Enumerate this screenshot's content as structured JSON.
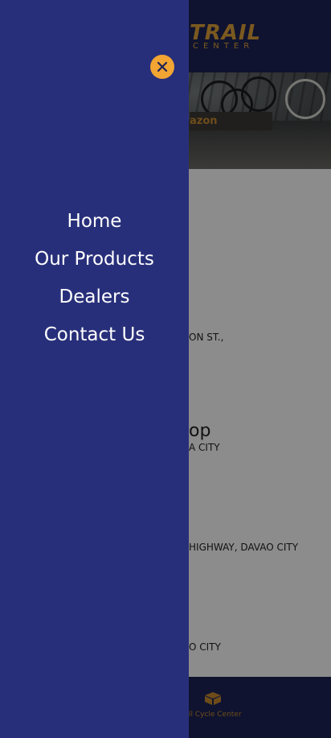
{
  "header": {
    "logo_main": "TRAIL",
    "logo_sub": "CENTER"
  },
  "hero": {
    "shop_button_label": "azon"
  },
  "dealers": [
    {
      "line": "ON ST.,"
    },
    {
      "title_fragment": "op",
      "line": "A CITY"
    },
    {
      "line": "HIGHWAY, DAVAO CITY"
    },
    {
      "line": "O CITY"
    }
  ],
  "bottom_nav": {
    "label": "ail Cycle Center",
    "icon": "box-icon"
  },
  "drawer": {
    "close_icon": "close-icon",
    "items": [
      {
        "label": "Home"
      },
      {
        "label": "Our Products"
      },
      {
        "label": "Dealers"
      },
      {
        "label": "Contact Us"
      }
    ]
  },
  "colors": {
    "drawer_bg": "#282f7a",
    "header_bg": "#1d2357",
    "accent": "#f2a533",
    "brand_gold": "#e1a23a"
  }
}
